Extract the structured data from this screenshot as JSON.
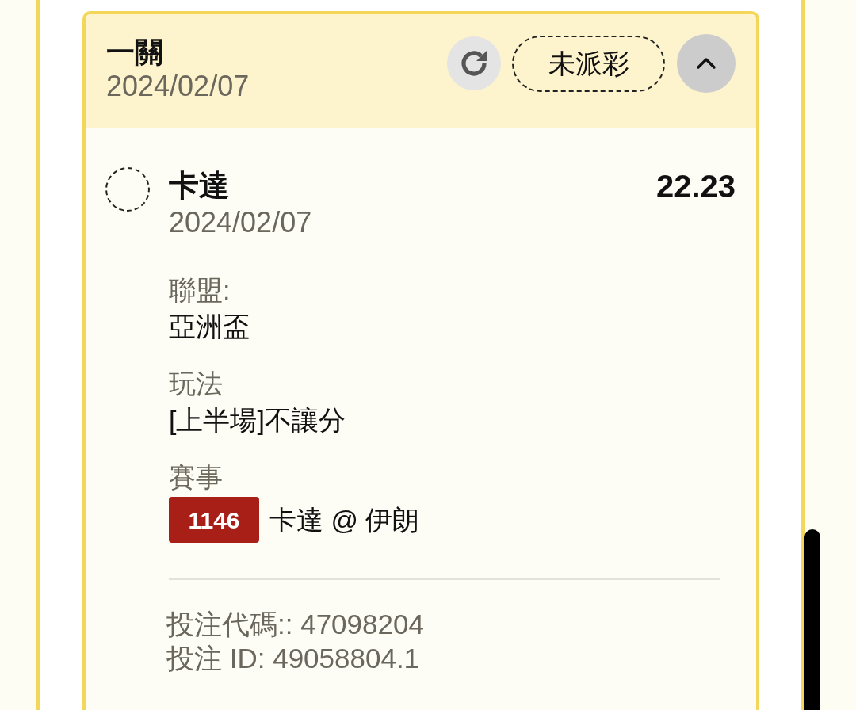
{
  "bet_card": {
    "title": "一關",
    "date": "2024/02/07",
    "status": "未派彩",
    "expanded": true,
    "selection": {
      "selected": false,
      "name": "卡達",
      "date": "2024/02/07",
      "odds": "22.23",
      "fields": [
        {
          "kind": "text",
          "label": "聯盟:",
          "value": "亞洲盃"
        },
        {
          "kind": "text",
          "label": "玩法",
          "value": "[上半場]不讓分"
        },
        {
          "kind": "match",
          "label": "賽事",
          "match_number": "1146",
          "value": "卡達 @ 伊朗"
        }
      ]
    },
    "footer": [
      "投注代碼:: 47098204",
      "投注 ID: 49058804.1"
    ]
  }
}
